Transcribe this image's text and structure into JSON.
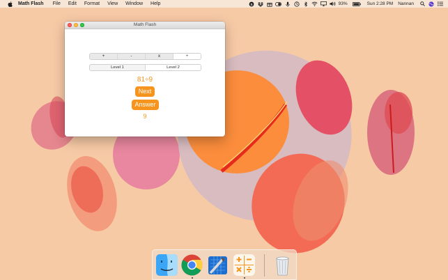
{
  "menubar": {
    "app_name": "Math Flash",
    "menus": [
      "File",
      "Edit",
      "Format",
      "View",
      "Window",
      "Help"
    ],
    "battery_percent": "93%",
    "clock": "Sun 2:28 PM",
    "user_name": "Nannan"
  },
  "window": {
    "title": "Math Flash",
    "operations": [
      "+",
      "-",
      "x",
      "÷"
    ],
    "selected_operation": "÷",
    "levels": [
      "Level 1",
      "Level 2"
    ],
    "selected_level": "Level 2",
    "question": "81÷9",
    "next_label": "Next",
    "answer_label": "Answer",
    "answer_value": "9"
  },
  "dock": {
    "items": [
      "finder-icon",
      "chrome-icon",
      "xcode-icon",
      "math-flash-icon",
      "trash-icon"
    ],
    "running": [
      "chrome-icon",
      "math-flash-icon"
    ]
  },
  "colors": {
    "accent": "#f7941d",
    "wallpaper": "#f6c9a6"
  }
}
